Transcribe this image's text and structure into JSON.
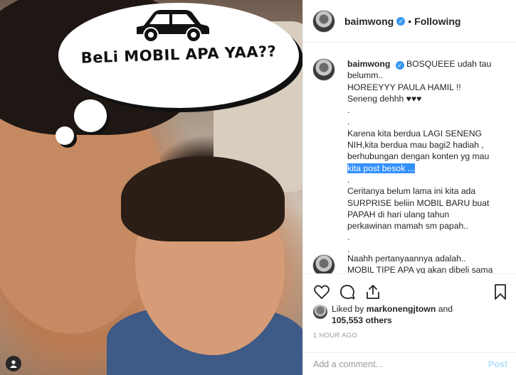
{
  "photo": {
    "thought_text": "BeLi MOBIL APA YAA??"
  },
  "header": {
    "username": "baimwong",
    "verified_mark": "✓",
    "separator": "•",
    "follow_status": "Following"
  },
  "caption": {
    "username": "baimwong",
    "first_line": "BOSQUEEE udah tau",
    "lines": [
      "belumm..",
      "HOREEYYY PAULA HAMIL !!",
      "Seneng dehhh ♥♥♥",
      ".",
      ".",
      "Karena kita berdua LAGI SENENG",
      "NIH,kita berdua mau bagi2 hadiah ,",
      "berhubungan dengan konten yg mau"
    ],
    "highlight_line": "kita post besok ...",
    "lines_after": [
      ".",
      "Ceritanya belum lama ini kita ada",
      "SURPRISE beliin MOBIL BARU buat",
      "PAPAH di hari ulang tahun",
      "perkawinan mamah sm papah..",
      ".",
      "."
    ],
    "next_lines": [
      "Naahh pertanyaannya adalah..",
      "MOBIL TIPE APA yg akan dibeli sama"
    ]
  },
  "likes": {
    "prefix": "Liked by",
    "liker": "markonengjtown",
    "and": "and",
    "count": "105,553 others"
  },
  "timestamp": "1 HOUR AGO",
  "comment_box": {
    "placeholder": "Add a comment...",
    "post_label": "Post"
  },
  "colors": {
    "verified_blue": "#3897f0",
    "post_disabled": "#b2dffc",
    "text_selection": "#3390ff"
  }
}
